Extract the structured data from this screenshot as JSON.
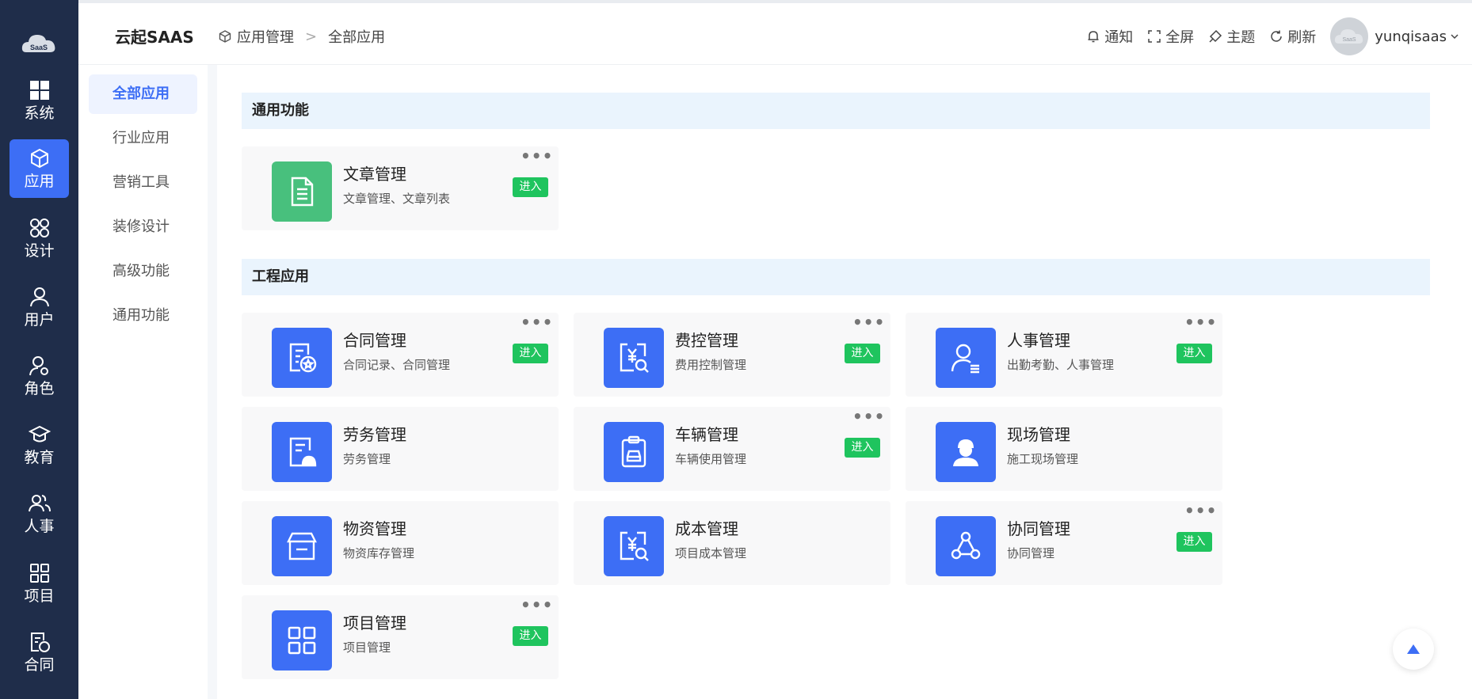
{
  "rail": {
    "logo_text": "SaaS",
    "items": [
      {
        "label": "系统",
        "icon": "grid-icon"
      },
      {
        "label": "应用",
        "icon": "cube-icon",
        "active": true
      },
      {
        "label": "设计",
        "icon": "command-icon"
      },
      {
        "label": "用户",
        "icon": "user-icon"
      },
      {
        "label": "角色",
        "icon": "user-gear-icon"
      },
      {
        "label": "教育",
        "icon": "graduation-cap-icon"
      },
      {
        "label": "人事",
        "icon": "users-icon"
      },
      {
        "label": "项目",
        "icon": "apps-icon"
      },
      {
        "label": "合同",
        "icon": "contract-icon"
      }
    ]
  },
  "header": {
    "brand": "云起SAAS",
    "breadcrumb": [
      "应用管理",
      "全部应用"
    ],
    "breadcrumb_sep": ">",
    "tools": {
      "notify": "通知",
      "fullscreen": "全屏",
      "theme": "主题",
      "refresh": "刷新"
    },
    "username": "yunqisaas",
    "avatar_text": "SaaS"
  },
  "submenu": {
    "items": [
      "全部应用",
      "行业应用",
      "营销工具",
      "装修设计",
      "高级功能",
      "通用功能"
    ]
  },
  "sections": [
    {
      "title": "通用功能",
      "cards": [
        {
          "title": "文章管理",
          "desc": "文章管理、文章列表",
          "icon": "document-icon",
          "enter": "进入",
          "more": "•••"
        }
      ]
    },
    {
      "title": "工程应用",
      "cards": [
        {
          "title": "合同管理",
          "desc": "合同记录、合同管理",
          "icon": "contract-icon",
          "enter": "进入",
          "more": "•••"
        },
        {
          "title": "费控管理",
          "desc": "费用控制管理",
          "icon": "yuan-search-icon",
          "enter": "进入",
          "more": "•••"
        },
        {
          "title": "人事管理",
          "desc": "出勤考勤、人事管理",
          "icon": "person-list-icon",
          "enter": "进入",
          "more": "•••"
        },
        {
          "title": "劳务管理",
          "desc": "劳务管理",
          "icon": "worker-doc-icon"
        },
        {
          "title": "车辆管理",
          "desc": "车辆使用管理",
          "icon": "car-clipboard-icon",
          "enter": "进入",
          "more": "•••"
        },
        {
          "title": "现场管理",
          "desc": "施工现场管理",
          "icon": "helmet-person-icon"
        },
        {
          "title": "物资管理",
          "desc": "物资库存管理",
          "icon": "box-icon"
        },
        {
          "title": "成本管理",
          "desc": "项目成本管理",
          "icon": "yuan-search-icon"
        },
        {
          "title": "协同管理",
          "desc": "协同管理",
          "icon": "collaboration-icon",
          "enter": "进入",
          "more": "•••"
        },
        {
          "title": "项目管理",
          "desc": "项目管理",
          "icon": "apps-icon",
          "enter": "进入",
          "more": "•••"
        }
      ]
    }
  ],
  "colors": {
    "rail_bg": "#1f2d4a",
    "accent": "#3d6ef5",
    "enter_green": "#1fc45e",
    "doc_green": "#48c07d",
    "section_bg": "#eaf4fd"
  }
}
